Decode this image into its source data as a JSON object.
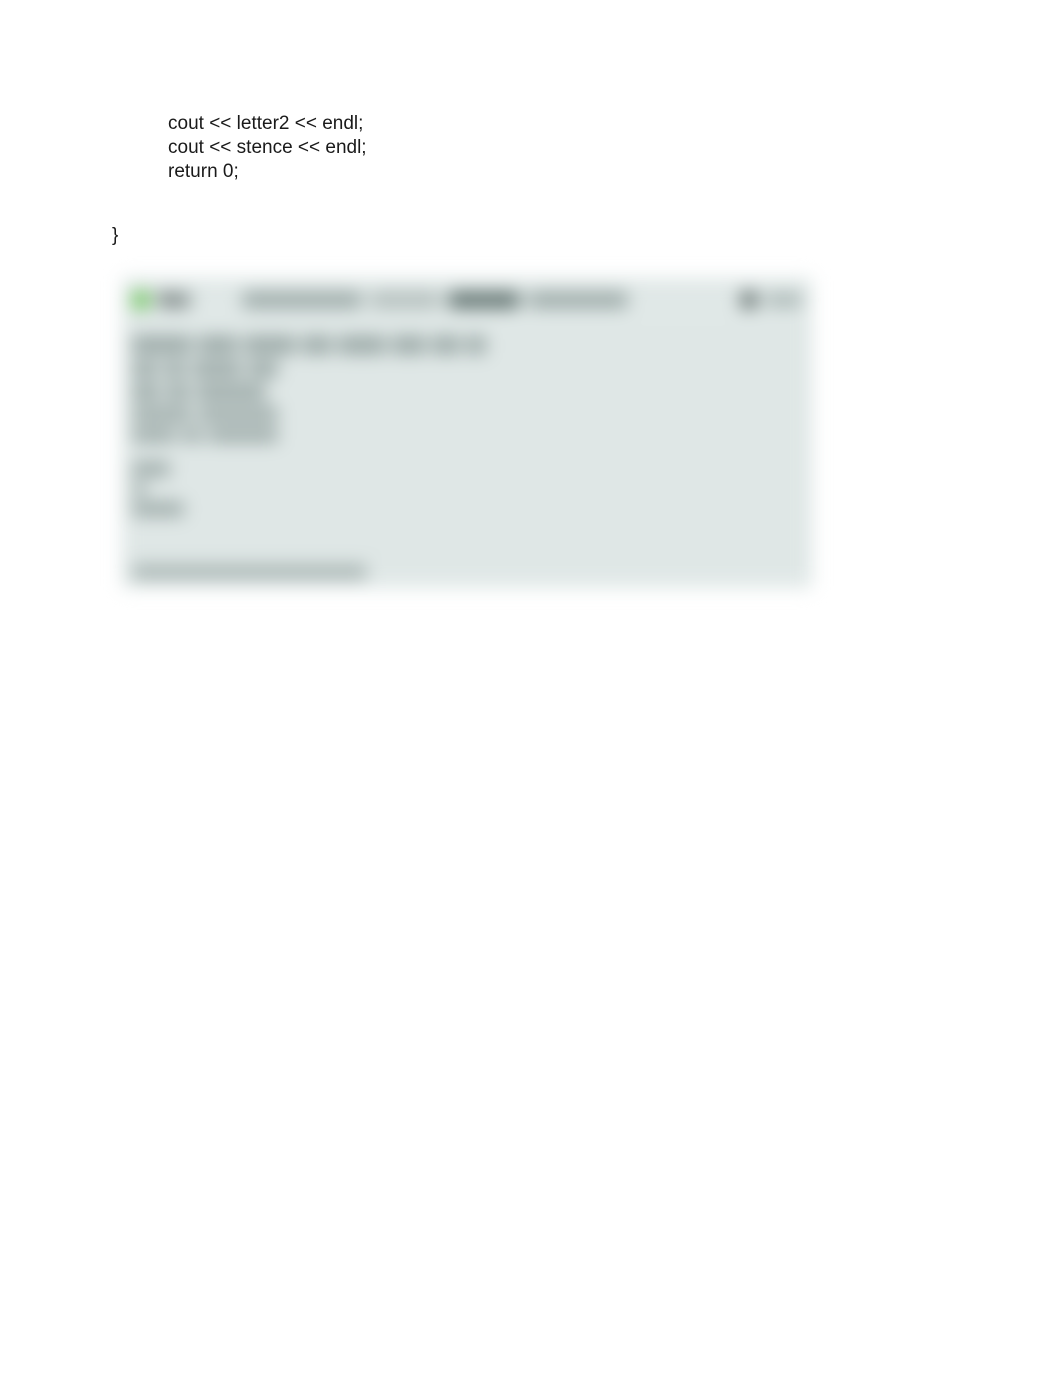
{
  "code": {
    "line1": "cout << letter2 << endl;",
    "line2": "cout << stence << endl;",
    "line3": "",
    "line4": "return 0;"
  },
  "brace": "}",
  "console": {
    "run_label": "Run",
    "command": "",
    "gear": "gear",
    "right_label": "",
    "output": "",
    "footer": ""
  }
}
